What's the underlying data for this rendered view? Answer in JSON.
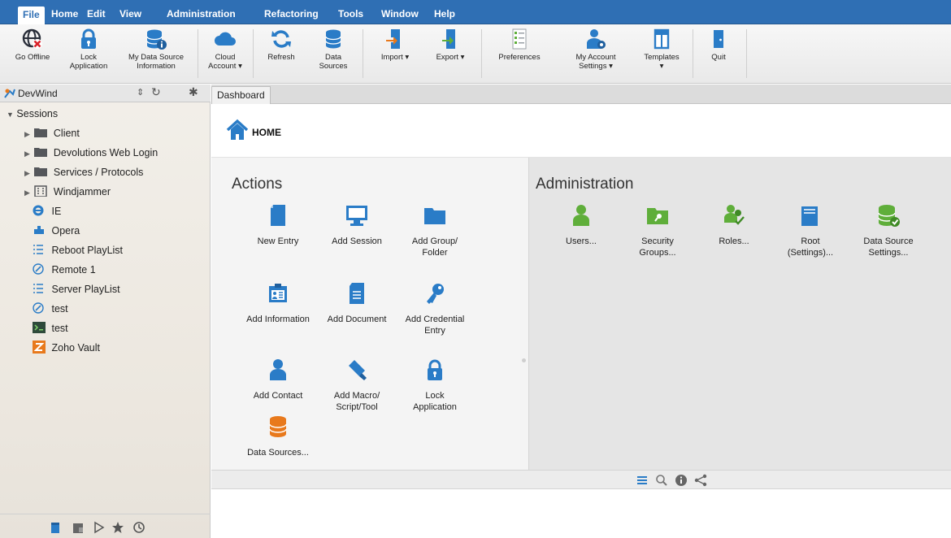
{
  "menu": {
    "items": [
      "File",
      "Home",
      "Edit",
      "View",
      "Administration",
      "Refactoring",
      "Tools",
      "Window",
      "Help"
    ],
    "active": "File"
  },
  "ribbon": {
    "go_offline": "Go Offline",
    "lock_app_1": "Lock",
    "lock_app_2": "Application",
    "ds_info_1": "My Data Source",
    "ds_info_2": "Information",
    "cloud_1": "Cloud",
    "cloud_2": "Account ▾",
    "refresh": "Refresh",
    "data_sources_1": "Data",
    "data_sources_2": "Sources",
    "import": "Import ▾",
    "export": "Export ▾",
    "preferences": "Preferences",
    "account_1": "My Account",
    "account_2": "Settings ▾",
    "templates_1": "Templates",
    "templates_2": "▾",
    "quit": "Quit"
  },
  "sidebar": {
    "title": "DevWind",
    "root": "Sessions",
    "items": [
      "Client",
      "Devolutions Web Login",
      "Services / Protocols",
      "Windjammer",
      "IE",
      "Opera",
      "Reboot PlayList",
      "Remote 1",
      "Server PlayList",
      "test",
      "test",
      "Zoho Vault"
    ]
  },
  "tabs": [
    "Dashboard"
  ],
  "dashboard": {
    "home": "HOME",
    "actions_title": "Actions",
    "admin_title": "Administration",
    "actions": {
      "new_entry": "New Entry",
      "add_session": "Add Session",
      "add_group_1": "Add Group/",
      "add_group_2": "Folder",
      "add_information": "Add Information",
      "add_document": "Add Document",
      "add_credential_1": "Add Credential",
      "add_credential_2": "Entry",
      "add_contact": "Add Contact",
      "add_macro_1": "Add Macro/",
      "add_macro_2": "Script/Tool",
      "lock_1": "Lock",
      "lock_2": "Application",
      "data_sources": "Data Sources..."
    },
    "admin": {
      "users": "Users...",
      "security_1": "Security",
      "security_2": "Groups...",
      "roles": "Roles...",
      "root_1": "Root",
      "root_2": "(Settings)...",
      "dss_1": "Data Source",
      "dss_2": "Settings..."
    }
  },
  "colors": {
    "menu_bg": "#2f6fb4",
    "icon_blue": "#2a7cc7",
    "icon_green": "#5fae3a",
    "icon_orange": "#e8791c"
  }
}
